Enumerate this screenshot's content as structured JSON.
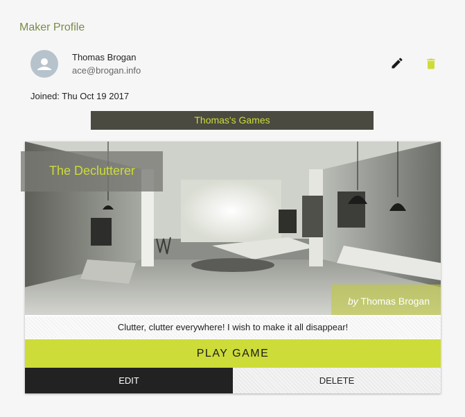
{
  "profile": {
    "section_title": "Maker Profile",
    "name": "Thomas Brogan",
    "email": "ace@brogan.info",
    "joined": "Joined: Thu Oct 19 2017",
    "icons": {
      "avatar": "person-icon",
      "edit": "pencil-icon",
      "delete": "trash-icon"
    }
  },
  "games_header": {
    "label": "Thomas's Games"
  },
  "game_card": {
    "title": "The Declutterer",
    "by_word": "by",
    "author": "Thomas Brogan",
    "description": "Clutter, clutter everywhere! I wish to make it all disappear!",
    "play_label": "PLAY GAME",
    "edit_label": "EDIT",
    "delete_label": "DELETE"
  },
  "colors": {
    "accent": "#cddc39",
    "banner_bg": "#4a4a40",
    "title_color": "#7a8a4a",
    "dark_button": "#222222"
  }
}
